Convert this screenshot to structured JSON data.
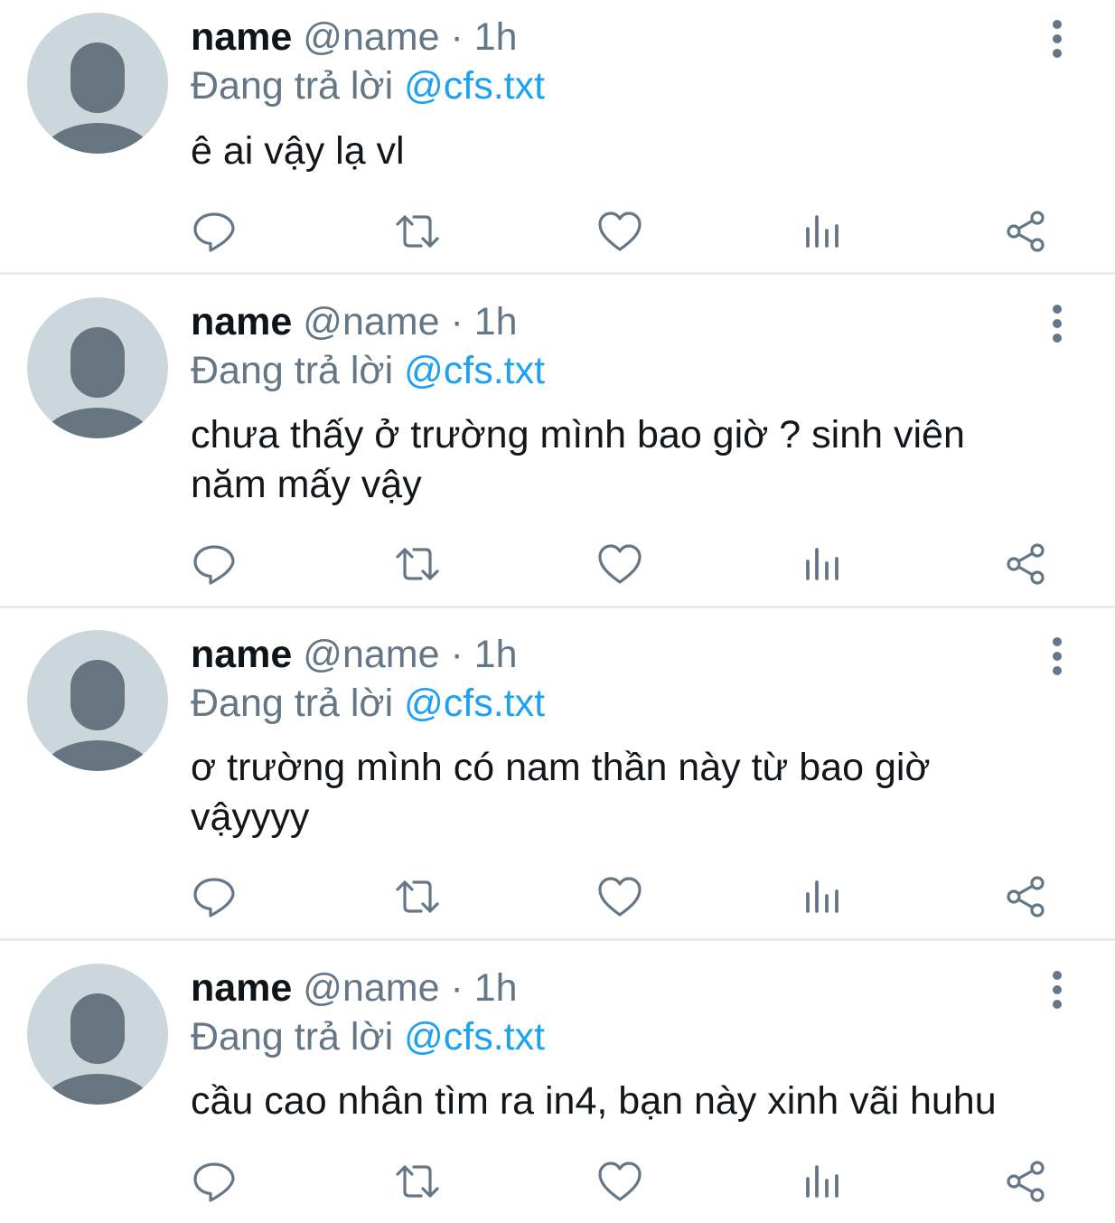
{
  "tweets": [
    {
      "name": "name",
      "handle": "@name",
      "separator": "·",
      "time": "1h",
      "reply_prefix": "Đang trả lời",
      "reply_to": "@cfs.txt",
      "text": "ê ai vậy lạ vl"
    },
    {
      "name": "name",
      "handle": "@name",
      "separator": "·",
      "time": "1h",
      "reply_prefix": "Đang trả lời",
      "reply_to": "@cfs.txt",
      "text": "chưa thấy ở trường mình bao giờ ? sinh viên năm mấy vậy"
    },
    {
      "name": "name",
      "handle": "@name",
      "separator": "·",
      "time": "1h",
      "reply_prefix": "Đang trả lời",
      "reply_to": "@cfs.txt",
      "text": "ơ trường mình có nam thần này từ bao giờ vậyyyy"
    },
    {
      "name": "name",
      "handle": "@name",
      "separator": "·",
      "time": "1h",
      "reply_prefix": "Đang trả lời",
      "reply_to": "@cfs.txt",
      "text": "cầu cao nhân tìm ra in4, bạn này xinh vãi huhu"
    }
  ],
  "icons": {
    "reply": "reply-icon",
    "retweet": "retweet-icon",
    "like": "heart-icon",
    "views": "analytics-icon",
    "share": "share-icon",
    "more": "more-vertical-icon",
    "avatar": "default-avatar-icon"
  },
  "colors": {
    "text_primary": "#0f1419",
    "text_secondary": "#657786",
    "link": "#1da1f2",
    "avatar_bg": "#ccd6dd",
    "avatar_fg": "#66757f",
    "divider": "#e6ecf0",
    "icon": "#657786"
  }
}
